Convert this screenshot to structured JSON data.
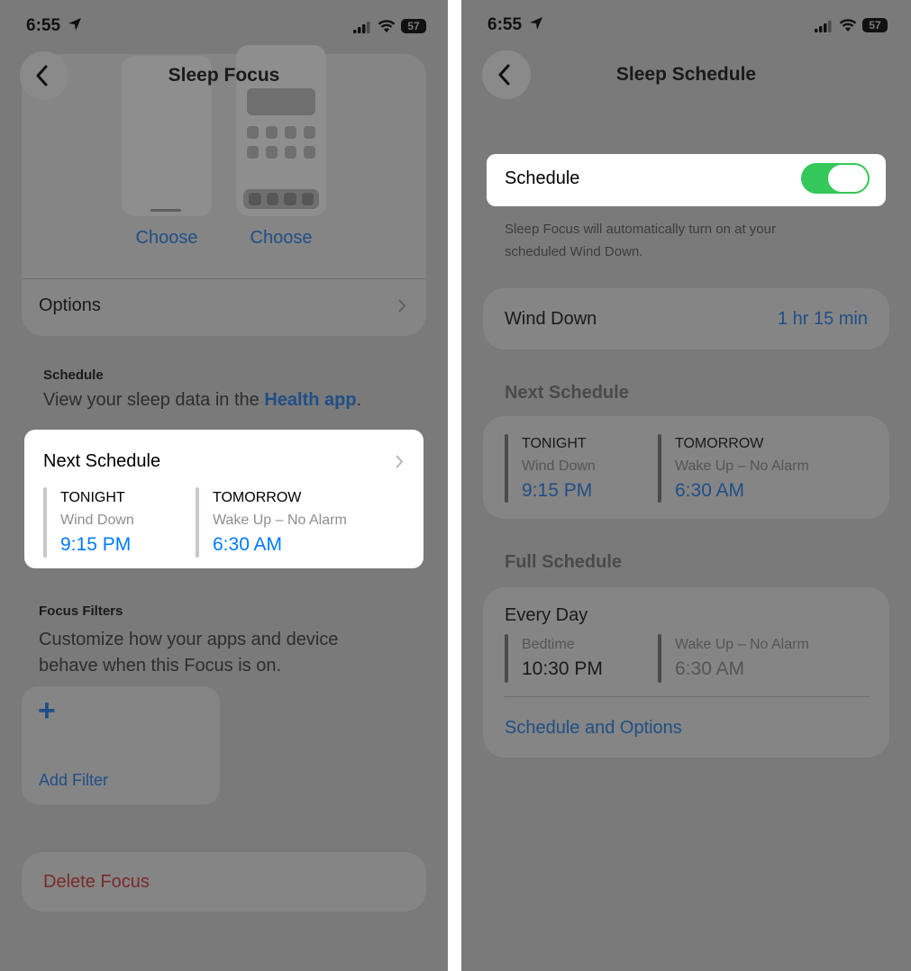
{
  "status": {
    "time": "6:55",
    "battery": "57"
  },
  "left": {
    "title": "Sleep Focus",
    "choose_lock": "Choose",
    "choose_home": "Choose",
    "options": "Options",
    "schedule_header": "Schedule",
    "schedule_desc_prefix": "View your sleep data in the ",
    "schedule_desc_link": "Health app",
    "schedule_desc_suffix": ".",
    "next_schedule": {
      "title": "Next Schedule",
      "tonight_label": "TONIGHT",
      "tonight_sub": "Wind Down",
      "tonight_time": "9:15 PM",
      "tomorrow_label": "TOMORROW",
      "tomorrow_sub": "Wake Up – No Alarm",
      "tomorrow_time": "6:30 AM"
    },
    "focus_filters_header": "Focus Filters",
    "focus_filters_desc_line1": "Customize how your apps and device",
    "focus_filters_desc_line2": "behave when this Focus is on.",
    "add_filter_plus": "+",
    "add_filter": "Add Filter",
    "delete_focus": "Delete Focus"
  },
  "right": {
    "title": "Sleep Schedule",
    "schedule_label": "Schedule",
    "schedule_on": true,
    "schedule_note_line1": "Sleep Focus will automatically turn on at your",
    "schedule_note_line2": "scheduled Wind Down.",
    "wind_down_label": "Wind Down",
    "wind_down_value": "1 hr 15 min",
    "next_schedule_header": "Next Schedule",
    "tonight_label": "TONIGHT",
    "tonight_sub": "Wind Down",
    "tonight_time": "9:15 PM",
    "tomorrow_label": "TOMORROW",
    "tomorrow_sub": "Wake Up – No Alarm",
    "tomorrow_time": "6:30 AM",
    "full_schedule_header": "Full Schedule",
    "every_day": "Every Day",
    "bedtime_label": "Bedtime",
    "bedtime_time": "10:30 PM",
    "wake_label": "Wake Up – No Alarm",
    "wake_time": "6:30 AM",
    "schedule_options_link": "Schedule and Options"
  },
  "colors": {
    "accent": "#007aff",
    "toggle_on": "#34c759",
    "overlay": "#7a7a7a",
    "destructive": "#ff3b30"
  }
}
